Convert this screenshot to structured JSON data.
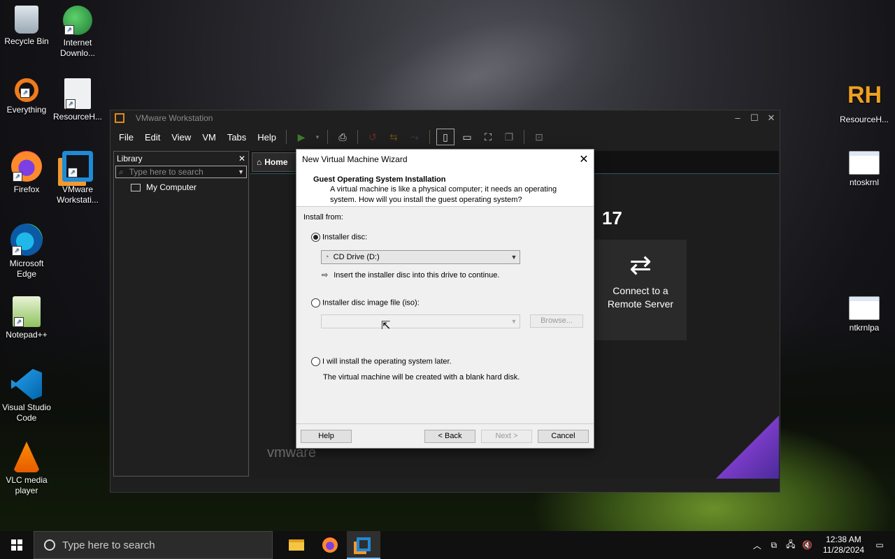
{
  "desktop_icons": [
    {
      "label": "Recycle Bin"
    },
    {
      "label": "Internet Downlo..."
    },
    {
      "label": "Everything"
    },
    {
      "label": "ResourceH..."
    },
    {
      "label": "Firefox"
    },
    {
      "label": "VMware Workstati..."
    },
    {
      "label": "Microsoft Edge"
    },
    {
      "label": "Notepad++"
    },
    {
      "label": "Visual Studio Code"
    },
    {
      "label": "VLC media player"
    },
    {
      "label": "ResourceH..."
    },
    {
      "label": "ntoskrnl"
    },
    {
      "label": "ntkrnlpa"
    }
  ],
  "vmware": {
    "title": "VMware Workstation",
    "menu": [
      "File",
      "Edit",
      "View",
      "VM",
      "Tabs",
      "Help"
    ],
    "library": {
      "title": "Library",
      "search_placeholder": "Type here to search",
      "tree_item": "My Computer"
    },
    "tab_home": "Home",
    "version_fragment": "17",
    "remote_card": "Connect to a Remote Server",
    "brand": "vmware"
  },
  "wizard": {
    "title": "New Virtual Machine Wizard",
    "heading": "Guest Operating System Installation",
    "subtext_1": "A virtual machine is like a physical computer; it needs an operating",
    "subtext_2": "system. How will you install the guest operating system?",
    "install_from": "Install from:",
    "option_disc": "Installer disc:",
    "disc_select": "CD Drive (D:)",
    "disc_hint": "Insert the installer disc into this drive to continue.",
    "option_iso": "Installer disc image file (iso):",
    "iso_value": "",
    "browse": "Browse...",
    "option_later": "I will install the operating system later.",
    "later_hint": "The virtual machine will be created with a blank hard disk.",
    "buttons": {
      "help": "Help",
      "back": "< Back",
      "next": "Next >",
      "cancel": "Cancel"
    },
    "selected_option": "Installer disc:"
  },
  "taskbar": {
    "search_placeholder": "Type here to search",
    "time": "12:38 AM",
    "date": "11/28/2024"
  },
  "colors": {
    "accent_vmware": "#e08a1e",
    "taskbar_active": "#76b9ed",
    "remote_card": "#2a2a2a"
  }
}
